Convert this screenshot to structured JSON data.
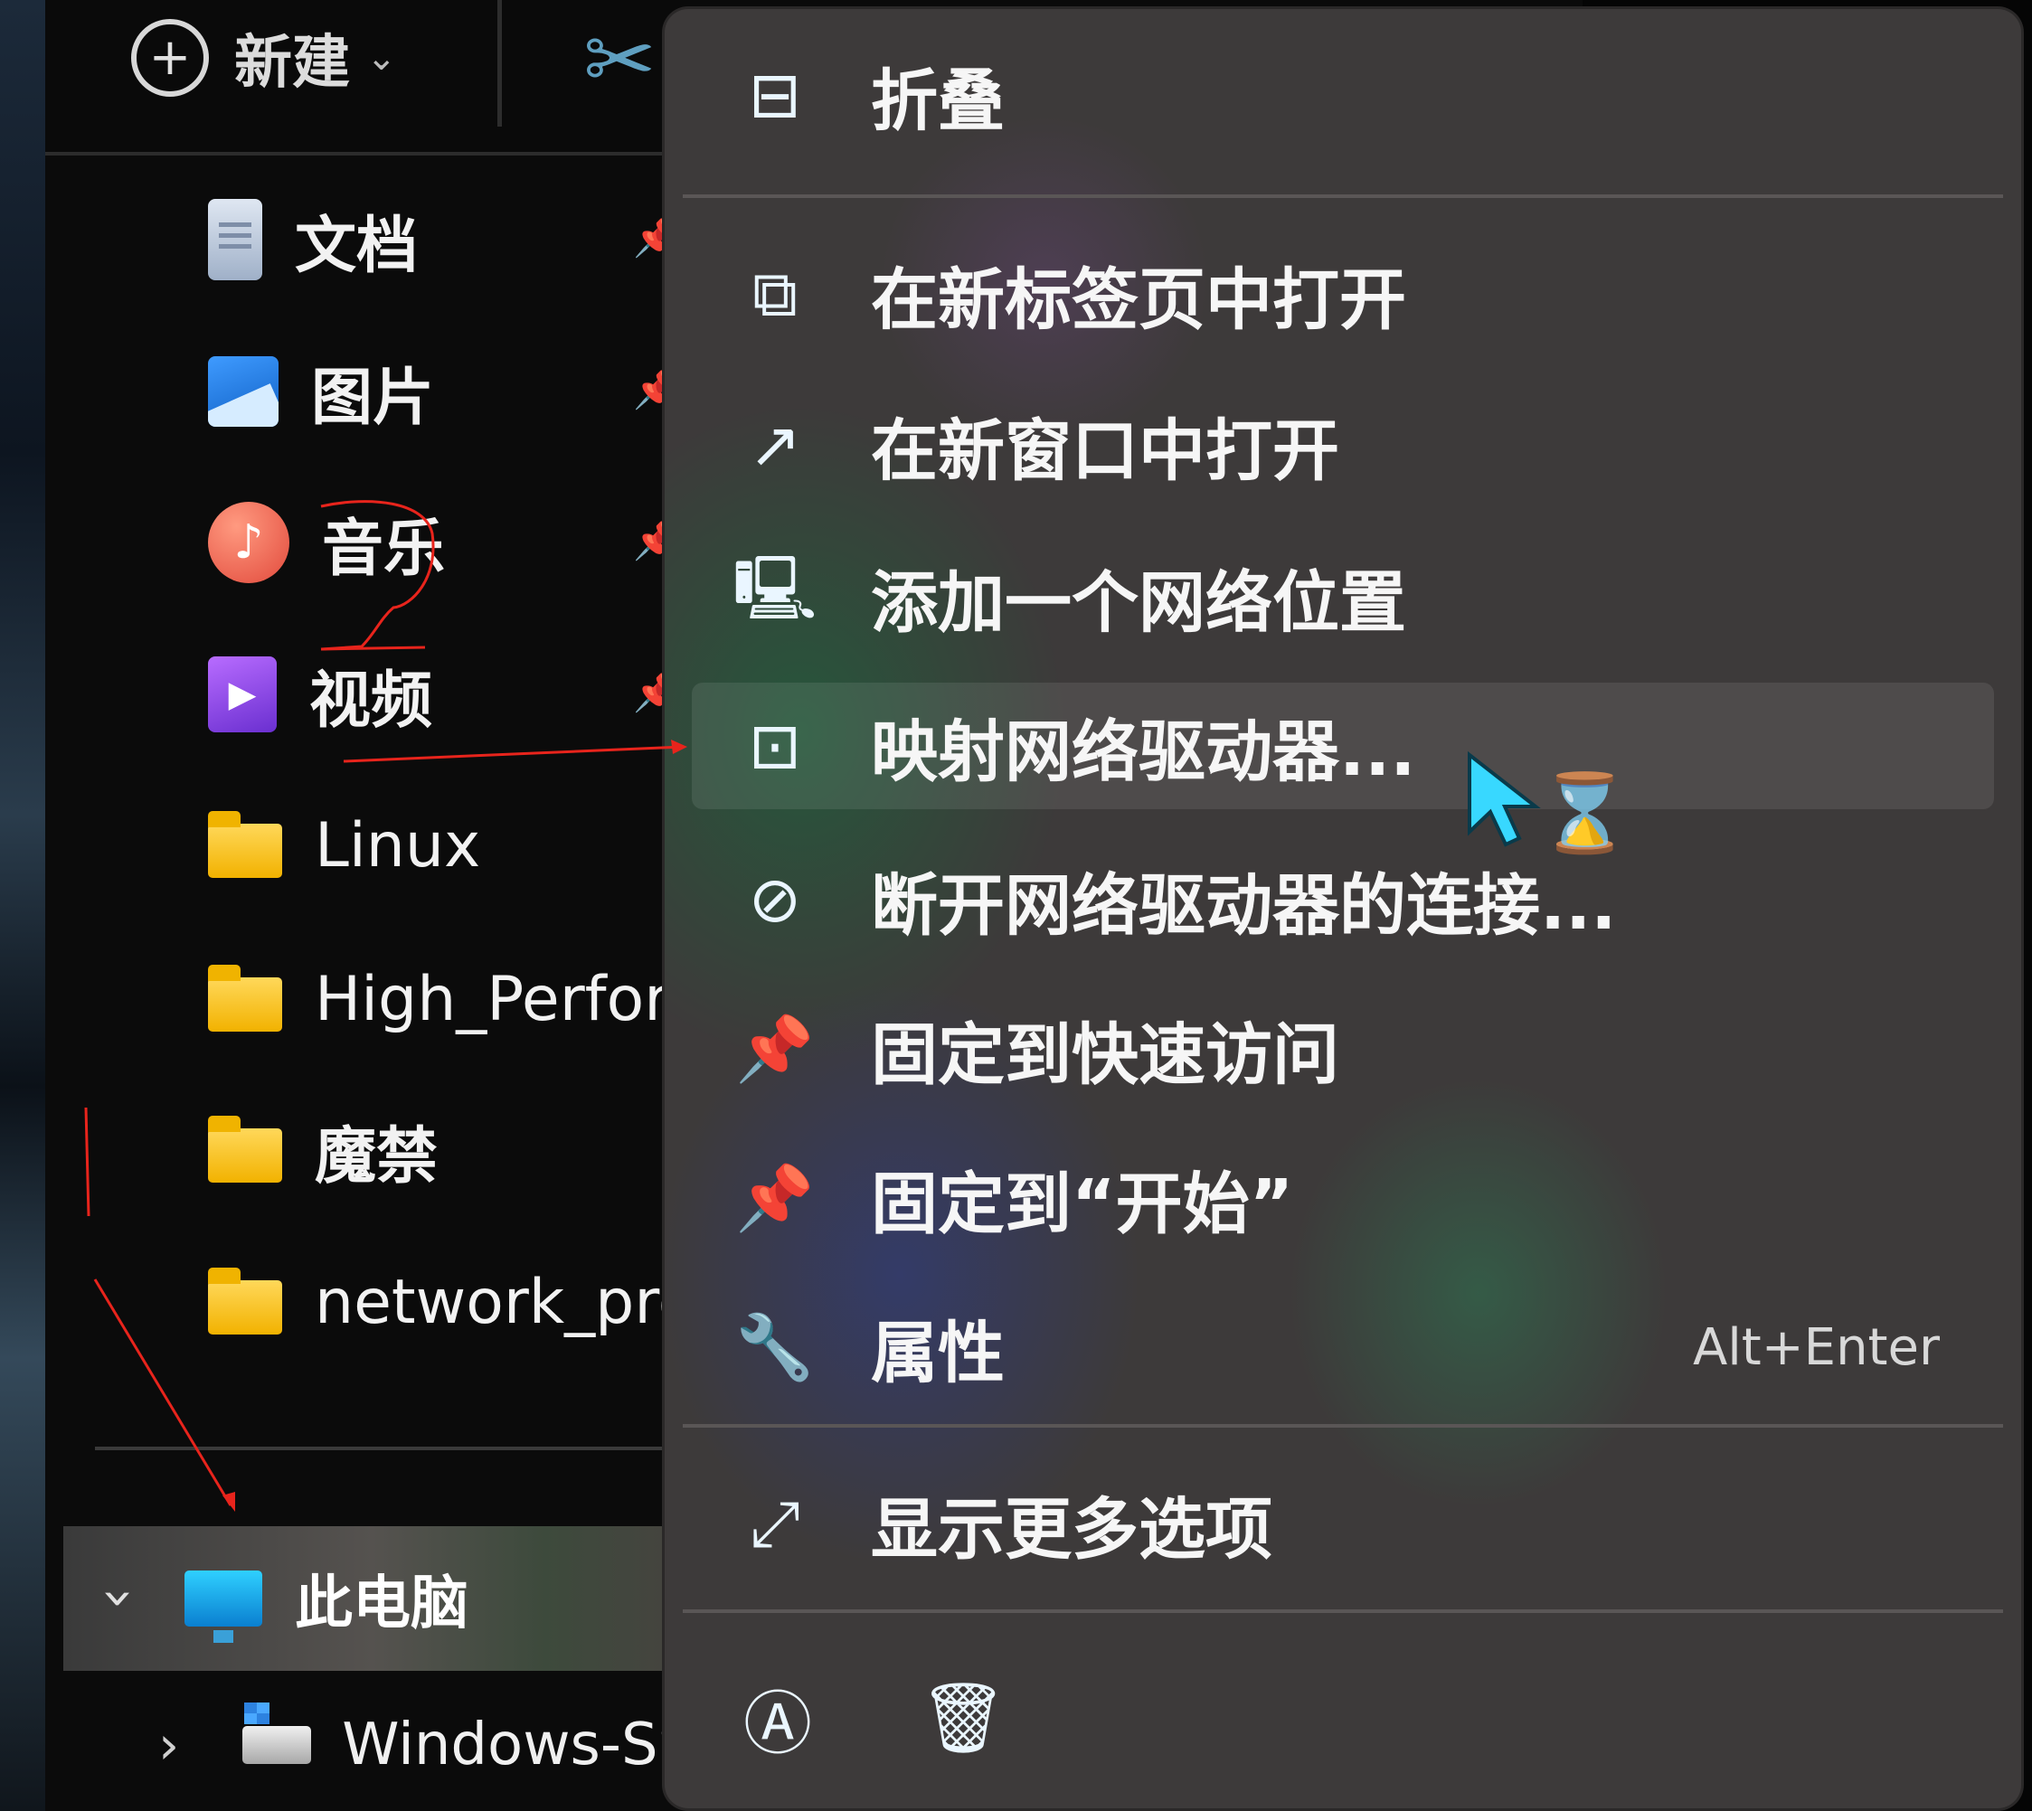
{
  "toolbar": {
    "new_label": "新建"
  },
  "nav": {
    "items": [
      {
        "label": "文档",
        "icon": "document-icon"
      },
      {
        "label": "图片",
        "icon": "picture-icon"
      },
      {
        "label": "音乐",
        "icon": "music-icon"
      },
      {
        "label": "视频",
        "icon": "video-icon"
      },
      {
        "label": "Linux",
        "icon": "folder-icon"
      },
      {
        "label": "High_Perform",
        "icon": "folder-icon"
      },
      {
        "label": "魔禁",
        "icon": "folder-icon"
      },
      {
        "label": "network_prog",
        "icon": "folder-icon"
      }
    ],
    "this_pc": "此电脑",
    "drive": "Windows-SS"
  },
  "context_menu": {
    "collapse": "折叠",
    "open_new_tab": "在新标签页中打开",
    "open_new_window": "在新窗口中打开",
    "add_network_location": "添加一个网络位置",
    "map_network_drive": "映射网络驱动器...",
    "disconnect_network_drive": "断开网络驱动器的连接...",
    "pin_quick_access": "固定到快速访问",
    "pin_start": "固定到“开始”",
    "properties": "属性",
    "properties_shortcut": "Alt+Enter",
    "show_more_options": "显示更多选项"
  },
  "annotations": {
    "number": "2"
  },
  "colors": {
    "annotation": "#e8241c",
    "menu_background": "#3d3a3a",
    "hover": "#4a4848"
  }
}
